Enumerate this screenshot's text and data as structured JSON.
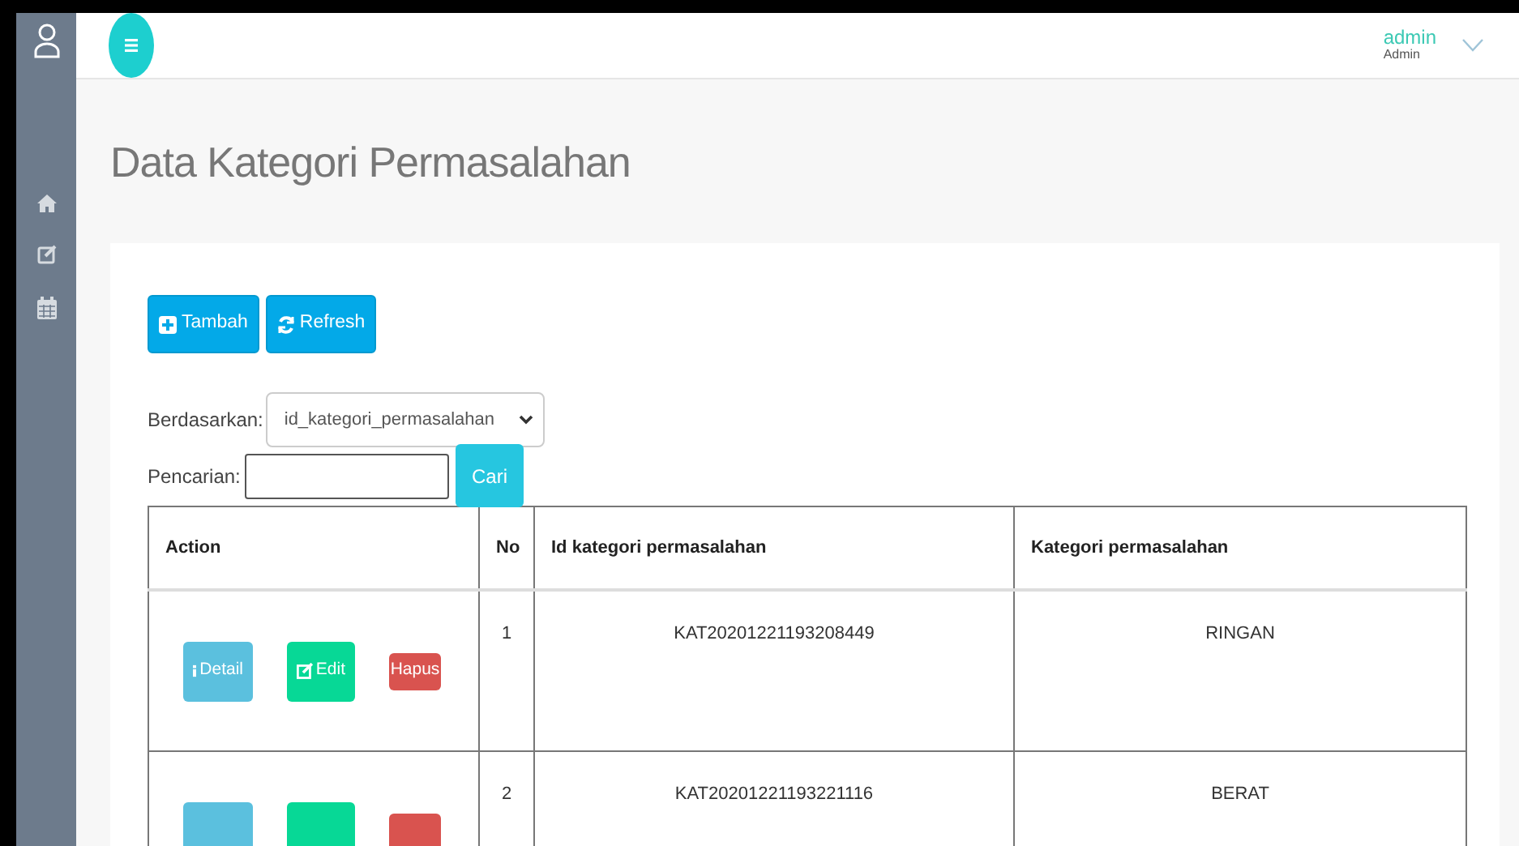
{
  "topbar": {
    "user_name": "admin",
    "user_role": "Admin"
  },
  "page_title": "Data Kategori Permasalahan",
  "toolbar": [
    {
      "kind": "add",
      "label": "Tambah"
    },
    {
      "kind": "refresh",
      "label": "Refresh"
    }
  ],
  "filter": {
    "label": "Berdasarkan:",
    "value": "id_kategori_permasalahan"
  },
  "search": {
    "label": "Pencarian",
    "separator": ":",
    "button": "Cari"
  },
  "table": {
    "columns": [
      "Action",
      "No",
      "Id kategori permasalahan",
      "Kategori permasalahan"
    ],
    "rows": [
      {
        "actions": [
          {
            "kind": "detail",
            "label": "Detail"
          },
          {
            "kind": "edit",
            "label": "Edit"
          },
          {
            "kind": "delete",
            "label": "Hapus"
          }
        ],
        "no": "1",
        "id": "KAT20201221193208449",
        "kategori": "RINGAN"
      },
      {
        "actions": [
          {
            "kind": "detail"
          },
          {
            "kind": "edit"
          },
          {
            "kind": "delete"
          }
        ],
        "no": "2",
        "id": "KAT20201221193221116",
        "kategori": "BERAT"
      }
    ]
  }
}
